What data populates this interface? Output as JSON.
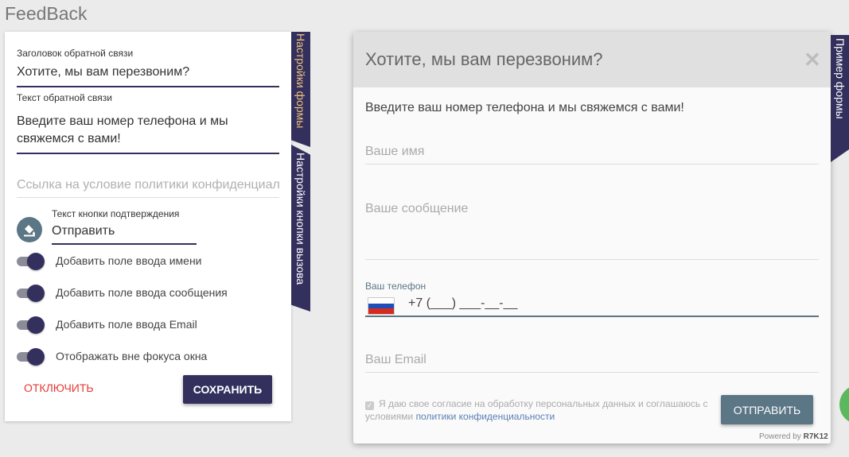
{
  "page": {
    "title": "FeedBack"
  },
  "settings": {
    "title_label": "Заголовок обратной связи",
    "title_value": "Хотите, мы вам перезвоним?",
    "text_label": "Текст обратной связи",
    "text_value": "Введите ваш номер телефона и мы свяжемся с вами!",
    "policy_placeholder": "Ссылка на условие политики конфиденциальности",
    "button_text_label": "Текст кнопки подтверждения",
    "button_text_value": "Отправить",
    "toggles": [
      {
        "label": "Добавить поле ввода имени",
        "on": true
      },
      {
        "label": "Добавить поле ввода сообщения",
        "on": true
      },
      {
        "label": "Добавить поле ввода Email",
        "on": true
      },
      {
        "label": "Отображать вне фокуса окна",
        "on": true
      }
    ],
    "disable_label": "ОТКЛЮЧИТЬ",
    "save_label": "СОХРАНИТЬ"
  },
  "tabs": {
    "form_settings": "Настройки формы",
    "button_settings": "Настройки кнопки вызова",
    "form_example": "Пример формы"
  },
  "preview": {
    "title": "Хотите, мы вам перезвоним?",
    "close": "✕",
    "description": "Введите ваш номер телефона и мы свяжемся с вами!",
    "name_placeholder": "Ваше имя",
    "message_placeholder": "Ваше сообщение",
    "phone_label": "Ваш телефон",
    "phone_mask": "+7 (___) ___-__-__",
    "email_placeholder": "Ваш Email",
    "consent_text": "Я даю свое согласие на обработку персональных данных и соглашаюсь с условиями",
    "consent_link": "политики конфиденциальности",
    "send_label": "ОТПРАВИТЬ",
    "powered_prefix": "Powered by",
    "powered_brand": "R7K12"
  },
  "colors": {
    "primary": "#33305e",
    "accent": "#f0c27a",
    "danger": "#e53935",
    "send": "#5b7685",
    "flag": [
      "#ffffff",
      "#1e4fb8",
      "#d52b1e"
    ]
  }
}
